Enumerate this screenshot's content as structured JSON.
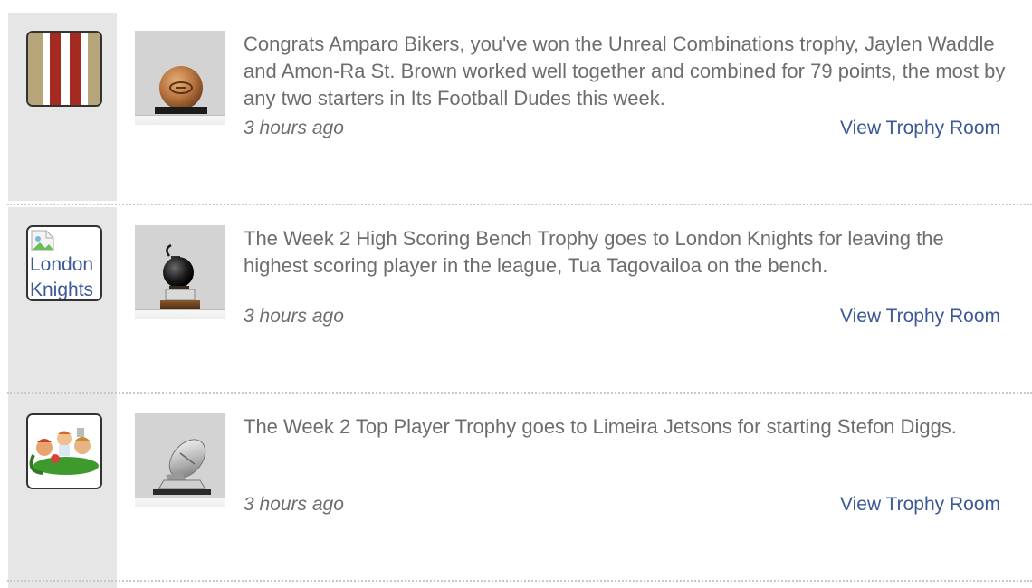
{
  "feed": {
    "items": [
      {
        "avatar_icon": "red-white-striped-team-logo",
        "trophy_icon": "football-ball-trophy-icon",
        "message": "Congrats Amparo Bikers, you've won the Unreal Combinations trophy, Jaylen Waddle and Amon-Ra St. Brown worked well together and combined for 79 points, the most by any two starters in Its Football Dudes this week.",
        "time": "3 hours ago",
        "link_label": "View Trophy Room"
      },
      {
        "avatar_icon": "broken-image-icon",
        "avatar_alt": "London Knights",
        "trophy_icon": "bomb-trophy-icon",
        "message": "The Week 2 High Scoring Bench Trophy goes to London Knights for leaving the highest scoring player in the league, Tua Tagovailoa on the bench.",
        "time": "3 hours ago",
        "link_label": "View Trophy Room"
      },
      {
        "avatar_icon": "cartoon-team-logo",
        "trophy_icon": "silver-football-trophy-icon",
        "message": "The Week 2 Top Player Trophy goes to Limeira Jetsons for starting Stefon Diggs.",
        "time": "3 hours ago",
        "link_label": "View Trophy Room"
      }
    ]
  },
  "colors": {
    "text": "#6d6d6d",
    "link": "#3b5998",
    "gutter": "#e6e6e6",
    "trophy_bg": "#d3d3d3",
    "stripe_red": "#a52a22",
    "stripe_gold": "#b7a57a"
  }
}
